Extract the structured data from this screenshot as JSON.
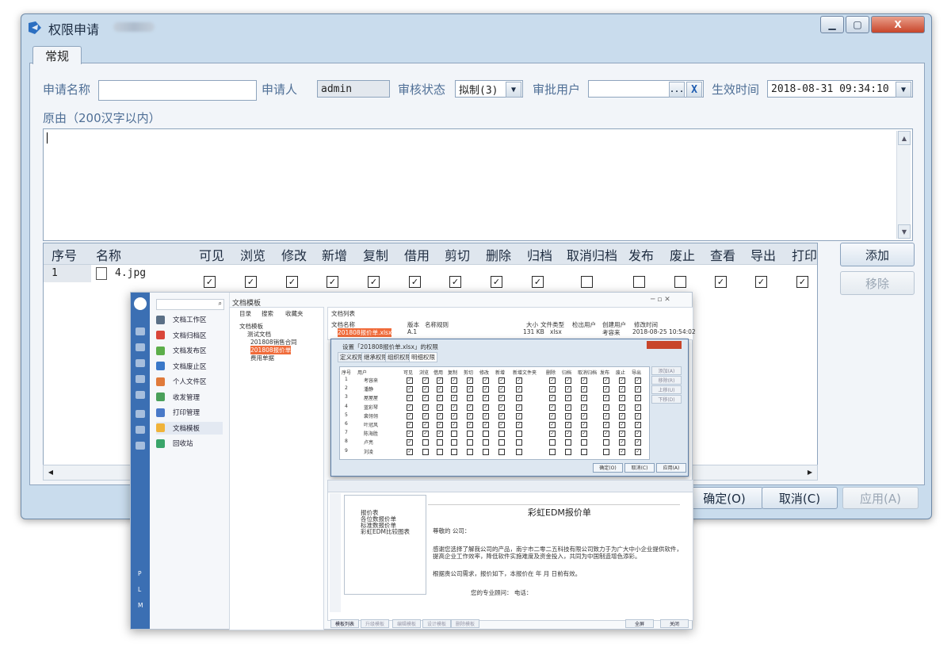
{
  "window": {
    "title": "权限申请",
    "minimize_glyph": "▁",
    "maximize_glyph": "▢",
    "close_glyph": "X"
  },
  "tabs": [
    {
      "label": "常规"
    }
  ],
  "form": {
    "name_label": "申请名称",
    "name_value": "",
    "applicant_label": "申请人",
    "applicant_value": "admin",
    "status_label": "审核状态",
    "status_value": "拟制(3)",
    "approver_label": "审批用户",
    "approver_value": "",
    "approver_browse": "...",
    "approver_clear": "X",
    "effective_label": "生效时间",
    "effective_value": "2018-08-31 09:34:10",
    "reason_label": "原由（200汉字以内）",
    "reason_value": ""
  },
  "permissions_table": {
    "columns": [
      "序号",
      "名称",
      "可见",
      "浏览",
      "修改",
      "新增",
      "复制",
      "借用",
      "剪切",
      "删除",
      "归档",
      "取消归档",
      "发布",
      "废止",
      "查看",
      "导出",
      "打印"
    ],
    "rows": [
      {
        "index": "1",
        "name": "4.jpg",
        "checks": [
          true,
          true,
          true,
          true,
          true,
          true,
          true,
          true,
          true,
          false,
          false,
          false,
          true,
          true,
          true
        ]
      }
    ]
  },
  "buttons": {
    "add": "添加",
    "remove": "移除",
    "ok": "确定(O)",
    "cancel": "取消(C)",
    "apply": "应用(A)"
  },
  "overlay_app": {
    "title": "文档模板",
    "nav_items": [
      "文档工作区",
      "文档归档区",
      "文档发布区",
      "文档废止区",
      "个人文件区",
      "收发管理",
      "打印管理",
      "文档模板",
      "回收站"
    ],
    "nav_colors": [
      "#5a6f86",
      "#d9463a",
      "#5cae4a",
      "#3a78c8",
      "#e07a3a",
      "#4aa05a",
      "#4a7ac8",
      "#f0b33a",
      "#3aa56a"
    ],
    "rail_letters": [
      "P",
      "L",
      "M"
    ],
    "tree_tabs": [
      "目录",
      "搜索",
      "收藏夹"
    ],
    "tree_items": [
      "文档模板",
      "测试文档",
      "201808销售合同",
      "201808报价单",
      "费用单据"
    ],
    "list_header": "文档列表",
    "list_columns": [
      "文档名称",
      "版本",
      "名称规则",
      "大小",
      "文件类型",
      "检出用户",
      "创建用户",
      "修改时间"
    ],
    "list_row": [
      "201808报价单.xlsx",
      "A.1",
      "",
      "131 KB",
      "xlsx",
      "",
      "考容来",
      "2018-08-25 10:54:02"
    ],
    "dialog_title": "设置「201808报价单.xlsx」的权限",
    "dialog_tabs": [
      "定义权限",
      "继承权限",
      "组织权限",
      "明细权限"
    ],
    "dialog_columns": [
      "序号",
      "用户",
      "可见",
      "浏览",
      "借用",
      "复制",
      "剪切",
      "修改",
      "新增",
      "新增文件夹",
      "删除",
      "归档",
      "取消归档",
      "发布",
      "废止",
      "导出"
    ],
    "dialog_users": [
      "考容来",
      "潘静",
      "屋屋屋",
      "蓝彩琴",
      "裴翎翎",
      "叶冠风",
      "陈海胜",
      "卢亮",
      "刘凌"
    ],
    "dialog_side_buttons": [
      "添加(A)",
      "移除(R)",
      "上移(U)",
      "下移(D)"
    ],
    "dialog_buttons": [
      "确定(O)",
      "取消(C)",
      "应用(A)"
    ],
    "sheet_outline": [
      "报价表",
      "各位数报价单",
      "标准数报价单",
      "彩虹EDM比较图表"
    ],
    "sheet_title": "彩虹EDM报价单",
    "sheet_rows": [
      "尊敬的             公司：",
      "感谢您选择了解我公司的产品，南宁市二零二五科技有限公司致力于为广大中小企业提供软件，提高企业工作效率，降低软件实施难度及资金投入，共同为中国制造增色添彩。",
      "根据贵公司需求，报价如下，本报价在    年    月    日前有效。",
      "您的专业顾问：                                        电话："
    ],
    "bottom_buttons": [
      "模板列表",
      "升级模板",
      "编辑模板",
      "设计模板",
      "删除模板",
      "全屏",
      "关闭"
    ]
  }
}
